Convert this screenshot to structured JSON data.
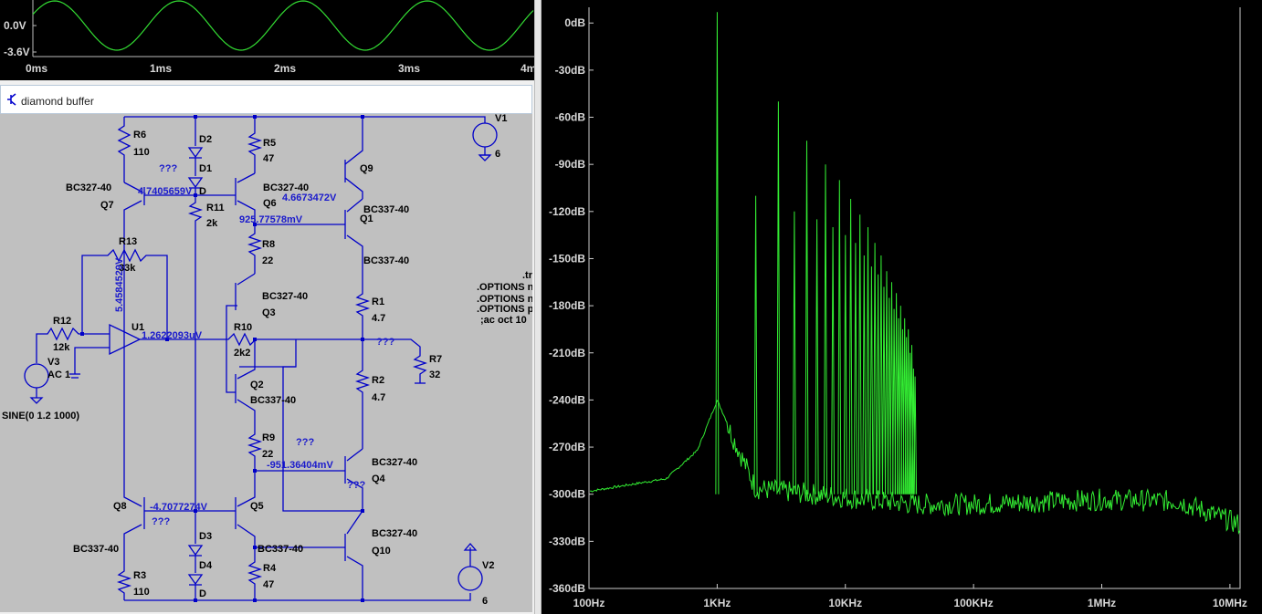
{
  "waveform": {
    "y_ticks": [
      "0.0V",
      "-3.6V"
    ],
    "x_ticks": [
      "0ms",
      "1ms",
      "2ms",
      "3ms",
      "4m"
    ],
    "trace_color": "#33dd33"
  },
  "schematic": {
    "window_title": "diamond buffer",
    "wire_color": "#0000c8",
    "labels": {
      "R6": "R6",
      "R6v": "110",
      "D2": "D2",
      "D1": "D1",
      "R5": "R5",
      "R5v": "47",
      "V1": "V1",
      "V1v": "6",
      "Q9": "Q9",
      "BC327_q7": "BC327-40",
      "Q7": "Q7",
      "BC327_q6": "BC327-40",
      "Q6": "Q6",
      "R11": "R11",
      "R11v": "2k",
      "Q1": "Q1",
      "BC337_q1": "BC337-40",
      "R8": "R8",
      "R8v": "22",
      "BC337_q9": "BC337-40",
      "R13": "R13",
      "R13v": "33k",
      "BC327_q3": "BC327-40",
      "Q3": "Q3",
      "R1": "R1",
      "R1v": "4.7",
      "R12": "R12",
      "R12v": "12k",
      "U1": "U1",
      "R10": "R10",
      "R10v": "2k2",
      "R7": "R7",
      "R7v": "32",
      "V3": "V3",
      "V3ac": "AC 1",
      "sine": "SINE(0 1.2 1000)",
      "Q2": "Q2",
      "BC337_q2": "BC337-40",
      "R2": "R2",
      "R2v": "4.7",
      "R9": "R9",
      "R9v": "22",
      "BC327_q4": "BC327-40",
      "Q4": "Q4",
      "Q8": "Q8",
      "Q5": "Q5",
      "BC327_q10": "BC327-40",
      "Q10": "Q10",
      "BC337_q8": "BC337-40",
      "BC337_q5": "BC337-40",
      "D3": "D3",
      "D4": "D4",
      "R3": "R3",
      "R3v": "110",
      "R4": "R4",
      "R4v": "47",
      "V2": "V2",
      "V2v": "6",
      "D_top": "D",
      "D_bot": "D"
    },
    "voltages": {
      "v1": "4.7405659V",
      "v2": "4.6673472V",
      "v3": "925.77578mV",
      "v4": "5.4584529V",
      "v5": "1.2622093uV",
      "v6": "-951.36404mV",
      "v7": "-4.7077274V"
    },
    "unknowns": [
      "???",
      "???",
      "???",
      "???",
      "???",
      "???"
    ],
    "directives": [
      ".tr",
      ".OPTIONS n",
      ".OPTIONS n",
      ".OPTIONS p",
      ";ac oct 10"
    ]
  },
  "fft": {
    "y_ticks": [
      "0dB",
      "-30dB",
      "-60dB",
      "-90dB",
      "-120dB",
      "-150dB",
      "-180dB",
      "-210dB",
      "-240dB",
      "-270dB",
      "-300dB",
      "-330dB",
      "-360dB"
    ],
    "x_ticks": [
      "100Hz",
      "1KHz",
      "10KHz",
      "100KHz",
      "1MHz",
      "10MHz"
    ],
    "trace_color": "#33ee33",
    "axis_color": "#cccccc"
  },
  "chart_data": {
    "type": "line",
    "title": "",
    "xlabel": "",
    "ylabel": "",
    "x_scale": "log",
    "xlim": [
      100,
      12000000
    ],
    "ylim": [
      -360,
      10
    ],
    "grid": false,
    "harmonics_hz": [
      1000,
      2000,
      3000,
      4000,
      5000,
      6000,
      7000,
      8000,
      9000,
      10000,
      11000,
      12000,
      13000,
      14000,
      15000,
      16000,
      17000,
      18000,
      19000,
      20000,
      21000,
      22000,
      23000,
      24000,
      25000,
      26000,
      27000,
      28000,
      29000,
      30000,
      31000,
      32000,
      33000,
      34000,
      35000
    ],
    "harmonics_db": [
      7,
      -110,
      -50,
      -120,
      -75,
      -125,
      -90,
      -130,
      -100,
      -135,
      -112,
      -140,
      -122,
      -148,
      -130,
      -155,
      -140,
      -160,
      -148,
      -168,
      -158,
      -175,
      -165,
      -182,
      -172,
      -188,
      -180,
      -195,
      -188,
      -200,
      -195,
      -210,
      -205,
      -220,
      -225
    ],
    "noise_floor": [
      {
        "x": 100,
        "y": -298
      },
      {
        "x": 400,
        "y": -290
      },
      {
        "x": 700,
        "y": -272
      },
      {
        "x": 1000,
        "y": -240
      },
      {
        "x": 2000,
        "y": -295
      },
      {
        "x": 35000,
        "y": -305
      },
      {
        "x": 100000,
        "y": -305
      },
      {
        "x": 1000000,
        "y": -302
      },
      {
        "x": 4000000,
        "y": -303
      },
      {
        "x": 12000000,
        "y": -318
      }
    ]
  }
}
